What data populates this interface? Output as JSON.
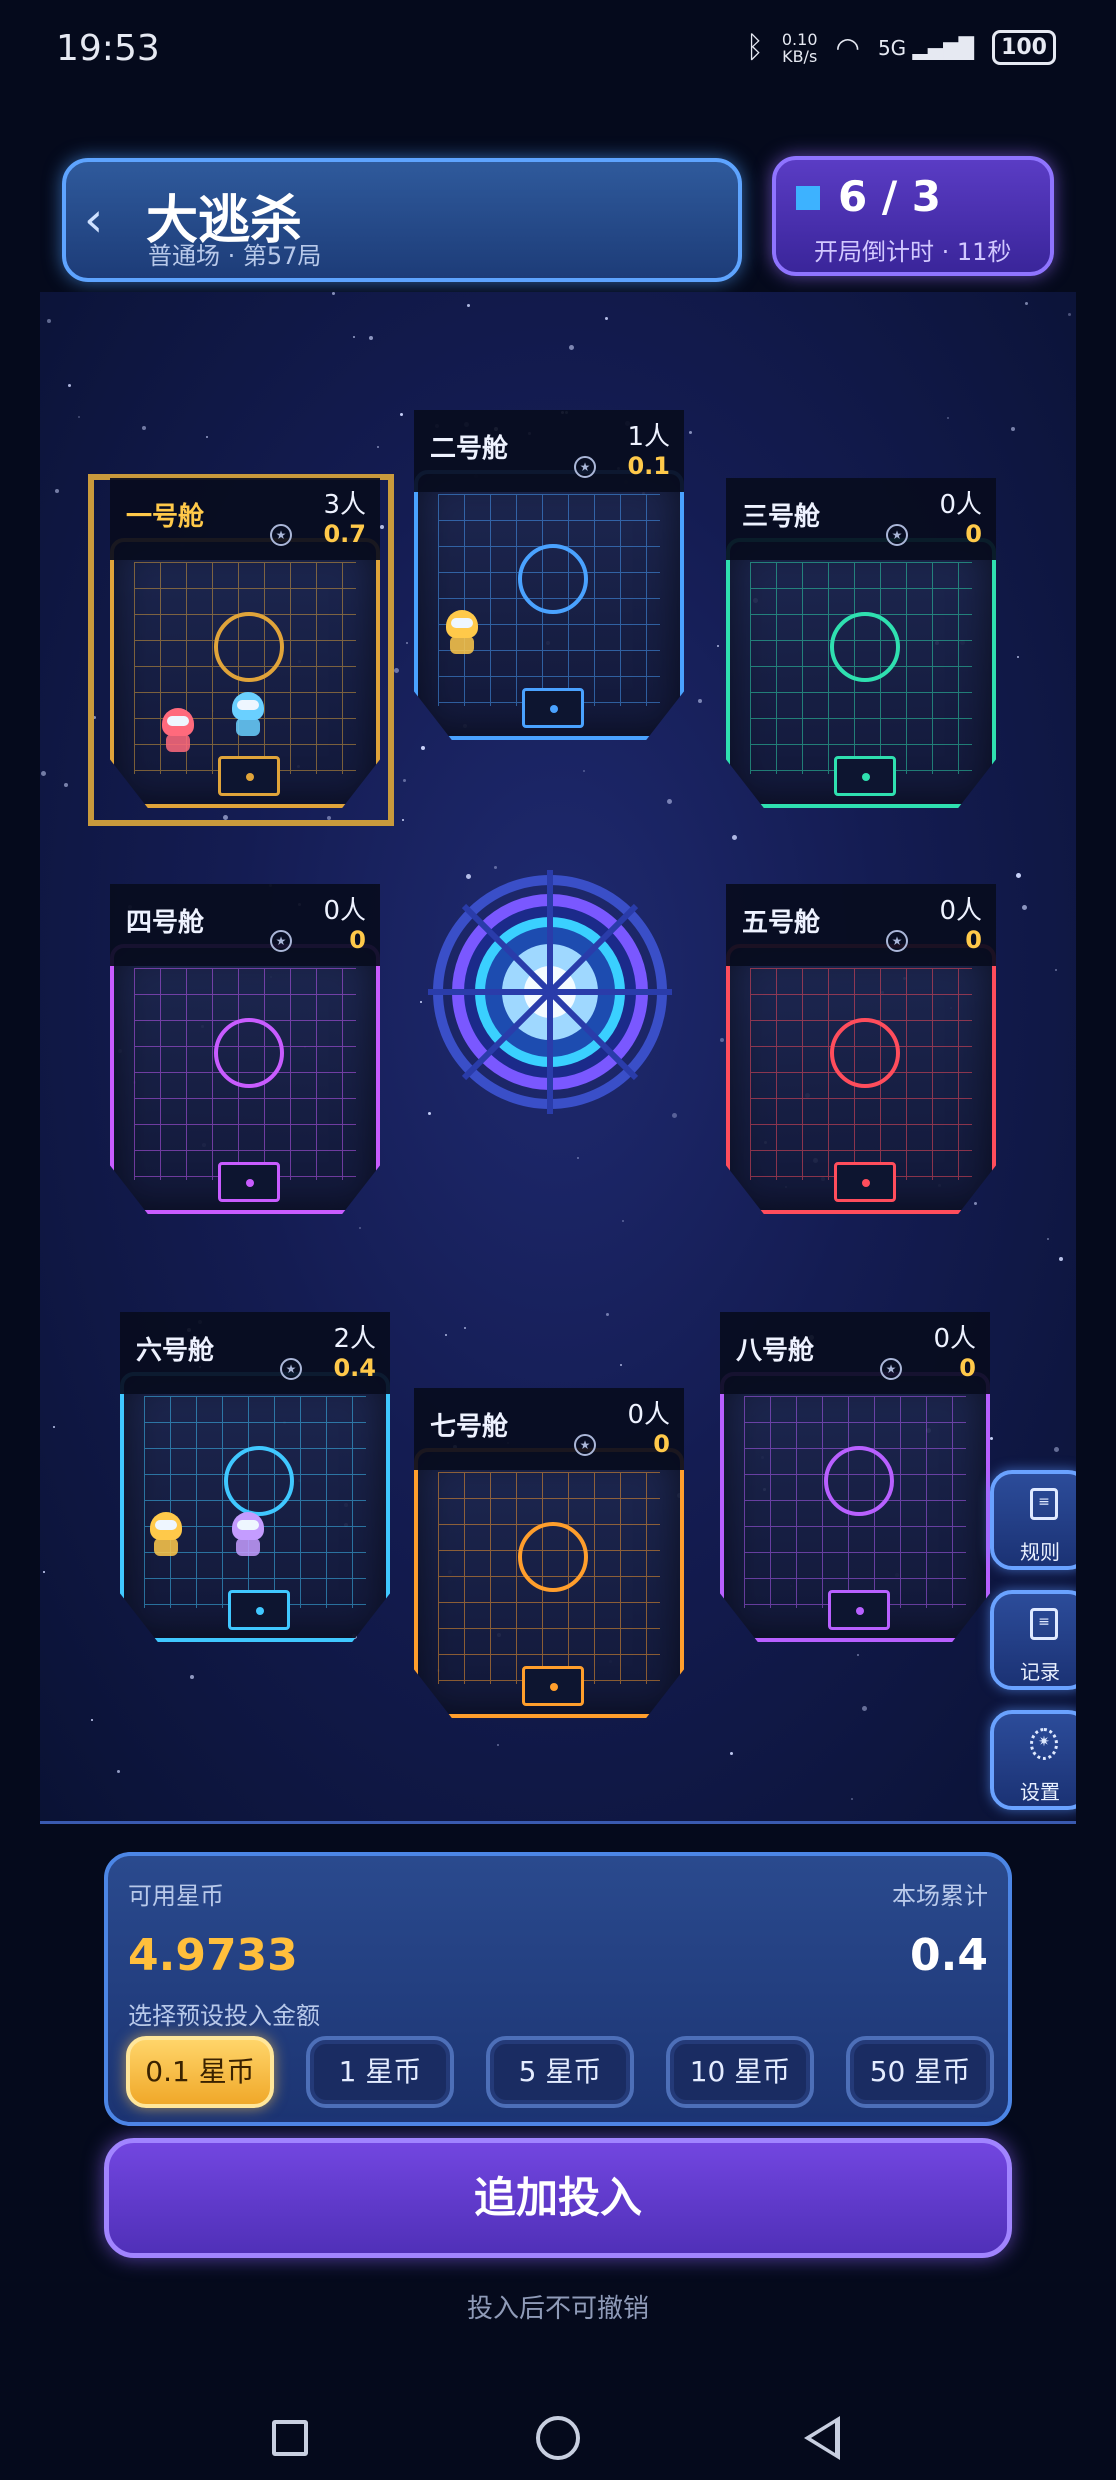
{
  "status": {
    "time": "19:53",
    "net_speed": "0.10",
    "net_unit": "KB/s",
    "signal": "5G",
    "battery": "100"
  },
  "header": {
    "title": "大逃杀",
    "subtitle": "普通场 · 第57局",
    "players": "6 / 3",
    "countdown": "开局倒计时 · 11秒"
  },
  "pods": [
    {
      "name": "一号舱",
      "people": "3人",
      "amount": "0.7",
      "color": "#e0a43a",
      "selected": true
    },
    {
      "name": "二号舱",
      "people": "1人",
      "amount": "0.1",
      "color": "#4aa2ff"
    },
    {
      "name": "三号舱",
      "people": "0人",
      "amount": "0",
      "color": "#2fe0b0"
    },
    {
      "name": "四号舱",
      "people": "0人",
      "amount": "0",
      "color": "#c85cff"
    },
    {
      "name": "五号舱",
      "people": "0人",
      "amount": "0",
      "color": "#ff4d5c"
    },
    {
      "name": "六号舱",
      "people": "2人",
      "amount": "0.4",
      "color": "#40c8ff"
    },
    {
      "name": "七号舱",
      "people": "0人",
      "amount": "0",
      "color": "#ff9e2c"
    },
    {
      "name": "八号舱",
      "people": "0人",
      "amount": "0",
      "color": "#b860ff"
    }
  ],
  "side": {
    "rules": "规则",
    "records": "记录",
    "settings": "设置"
  },
  "bet": {
    "available_label": "可用星币",
    "available_value": "4.9733",
    "total_label": "本场累计",
    "total_value": "0.4",
    "choose_label": "选择预设投入金额",
    "amounts": [
      "0.1 星币",
      "1 星币",
      "5 星币",
      "10 星币",
      "50 星币"
    ],
    "selected_index": 0
  },
  "add_button": "追加投入",
  "note": "投入后不可撤销"
}
